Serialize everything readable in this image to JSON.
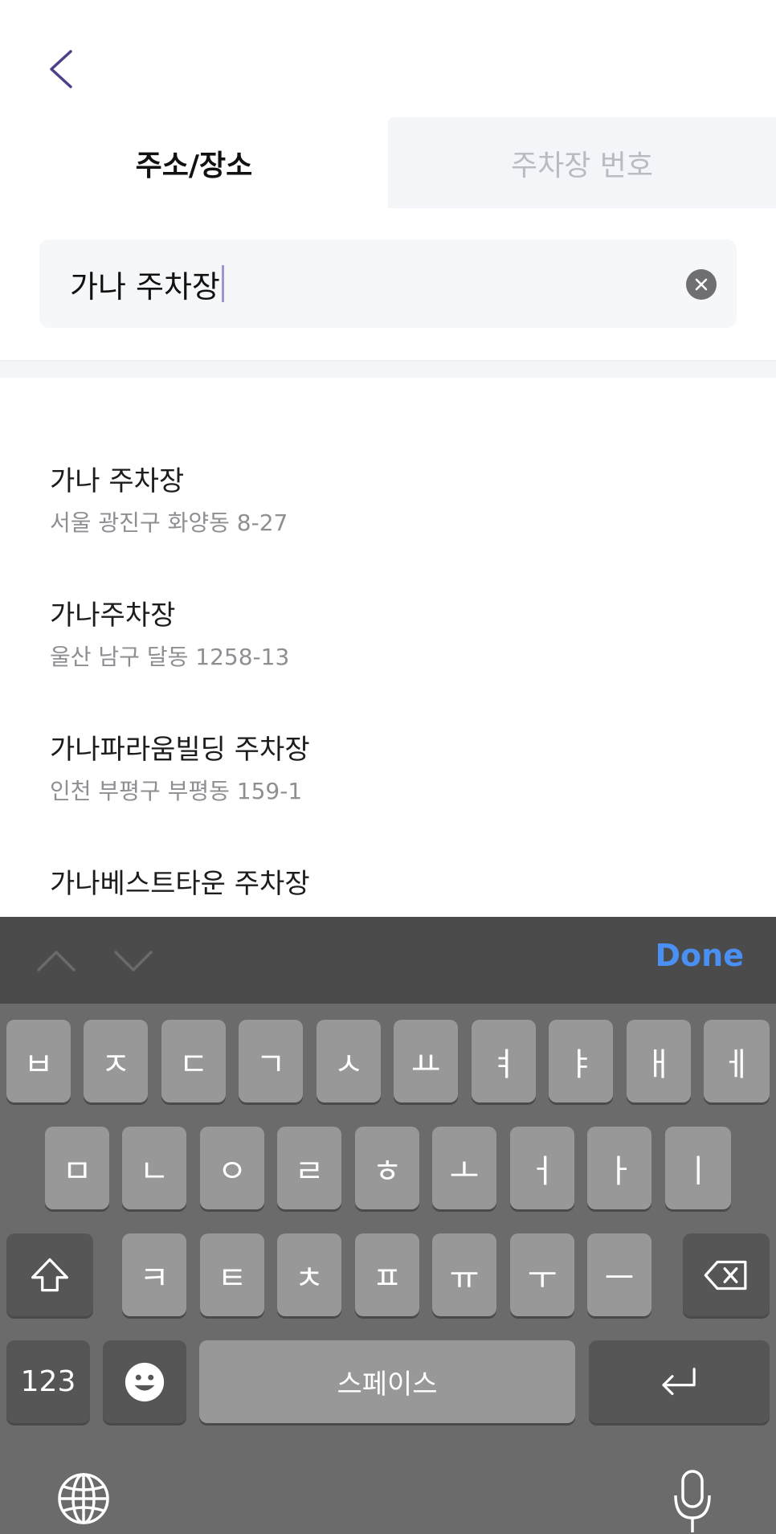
{
  "header": {
    "back_icon": "chevron-left-icon"
  },
  "tabs": [
    {
      "label": "주소/장소",
      "active": true
    },
    {
      "label": "주차장 번호",
      "active": false
    }
  ],
  "search": {
    "value": "가나 주차장",
    "clear_icon": "clear-icon"
  },
  "results": [
    {
      "name": "가나 주차장",
      "address": "서울 광진구 화양동 8-27"
    },
    {
      "name": "가나주차장",
      "address": "울산 남구 달동 1258-13"
    },
    {
      "name": "가나파라움빌딩 주차장",
      "address": "인천 부평구 부평동 159-1"
    },
    {
      "name": "가나베스트타운 주차장",
      "address": ""
    }
  ],
  "keyboard": {
    "toolbar": {
      "done_label": "Done",
      "prev_icon": "chevron-up-icon",
      "next_icon": "chevron-down-icon"
    },
    "row1": [
      "ㅂ",
      "ㅈ",
      "ㄷ",
      "ㄱ",
      "ㅅ",
      "ㅛ",
      "ㅕ",
      "ㅑ",
      "ㅐ",
      "ㅔ"
    ],
    "row2": [
      "ㅁ",
      "ㄴ",
      "ㅇ",
      "ㄹ",
      "ㅎ",
      "ㅗ",
      "ㅓ",
      "ㅏ",
      "ㅣ"
    ],
    "row3": [
      "ㅋ",
      "ㅌ",
      "ㅊ",
      "ㅍ",
      "ㅠ",
      "ㅜ",
      "ㅡ"
    ],
    "numbers_label": "123",
    "space_label": "스페이스",
    "shift_icon": "shift-icon",
    "backspace_icon": "backspace-icon",
    "emoji_icon": "emoji-icon",
    "return_icon": "return-icon",
    "globe_icon": "globe-icon",
    "mic_icon": "microphone-icon"
  },
  "colors": {
    "accent": "#4a8ff2",
    "back_arrow": "#4a4287",
    "tab_inactive_bg": "#f4f5f8"
  }
}
